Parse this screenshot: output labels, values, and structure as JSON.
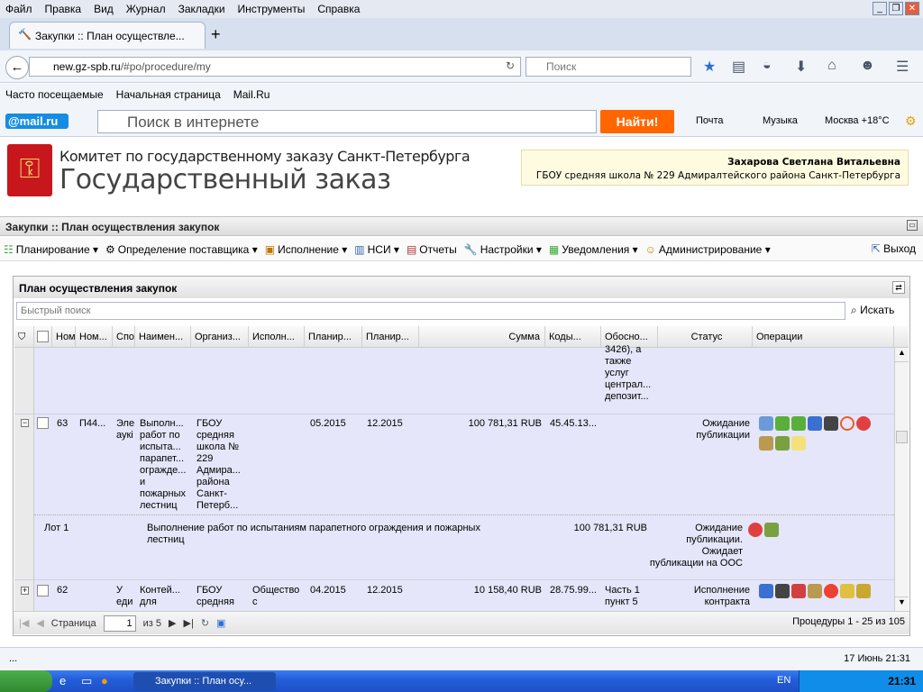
{
  "browser": {
    "menu": [
      "Файл",
      "Правка",
      "Вид",
      "Журнал",
      "Закладки",
      "Инструменты",
      "Справка"
    ],
    "tab_title": "Закупки :: План осуществле...",
    "url_domain": "new.gz-spb.ru",
    "url_path": "/#po/procedure/my",
    "search_placeholder": "Поиск",
    "bookmarks": [
      "Часто посещаемые",
      "Начальная страница",
      "Mail.Ru"
    ],
    "mail_logo": "@mail.ru",
    "mail_search_placeholder": "Поиск в интернете",
    "find_button": "Найти!",
    "mail_links": [
      "Почта",
      "Музыка",
      "Москва +18°C"
    ]
  },
  "header": {
    "org_line1": "Комитет по государственному заказу Санкт-Петербурга",
    "org_line2": "Государственный заказ",
    "user_name": "Захарова Светлана Витальевна",
    "user_org": "ГБОУ средняя школа № 229 Адмиралтейского района Санкт-Петербурга"
  },
  "section_title": "Закупки :: План осуществления закупок",
  "app_menu": [
    "Планирование",
    "Определение поставщика",
    "Исполнение",
    "НСИ",
    "Отчеты",
    "Настройки",
    "Уведомления",
    "Администрирование"
  ],
  "logout": "Выход",
  "panel": {
    "title": "План осуществления закупок",
    "quick_search_placeholder": "Быстрый поиск",
    "search_button": "Искать",
    "columns": [
      "Ном",
      "Ном...",
      "Спо",
      "Наимен...",
      "Организ...",
      "Исполн...",
      "Планир...",
      "Планир...",
      "Сумма",
      "Коды...",
      "Обосно...",
      "Статус",
      "Операции"
    ],
    "partial_row": {
      "justification": "3426), а\nтакже\nуслуг\nцентрал...\nдепозит..."
    },
    "rows": [
      {
        "num": "63",
        "code": "П44...",
        "method": "Эле\nаукі",
        "name": "Выполн...\nработ по\nиспыта...\nпарапет...\nогражде...\nи\nпожарных\nлестниц",
        "org": "ГБОУ\nсредняя\nшкола №\n229\nАдмира...\nрайона\nСанкт-\nПетерб...",
        "executor": "",
        "plan_start": "05.2015",
        "plan_end": "12.2015",
        "sum": "100 781,31 RUB",
        "codes": "45.45.13...",
        "justification": "",
        "status": "Ожидание\nпубликации"
      },
      {
        "num": "62",
        "code": "",
        "method": "У\nеди",
        "name": "Контей...\nдля",
        "org": "ГБОУ\nсредняя",
        "executor": "Общество\nс",
        "plan_start": "04.2015",
        "plan_end": "12.2015",
        "sum": "10 158,40 RUB",
        "codes": "28.75.99...",
        "justification": "Часть 1\nпункт 5",
        "status": "Исполнение\nконтракта"
      }
    ],
    "lot": {
      "label": "Лот 1",
      "name": "Выполнение работ по испытаниям парапетного ограждения и пожарных\nлестниц",
      "sum": "100 781,31 RUB",
      "status": "Ожидание\nпубликации.\nОжидает\nпубликации на ООС"
    },
    "pager": {
      "page_label": "Страница",
      "page": "1",
      "of": "из 5",
      "info": "Процедуры 1 - 25 из 105"
    }
  },
  "statusbar": {
    "left": "...",
    "right": "17 Июнь 21:31"
  },
  "taskbar": {
    "item": "Закупки :: План осу...",
    "lang": "EN",
    "clock": "21:31"
  }
}
